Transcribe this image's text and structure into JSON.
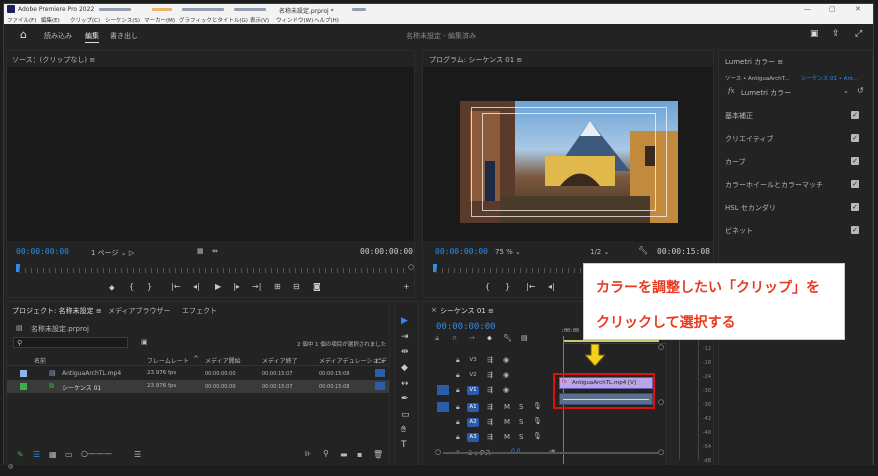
{
  "app": {
    "title": "Adobe Premiere Pro 2022",
    "doc_title": "名称未設定.prproj *"
  },
  "menu": [
    "ファイル(F)",
    "編集(E)",
    "クリップ(C)",
    "シーケンス(S)",
    "マーカー(M)",
    "グラフィックとタイトル(G)",
    "表示(V)",
    "ウィンドウ(W)",
    "ヘルプ(H)"
  ],
  "header": {
    "tabs": [
      "読み込み",
      "編集",
      "書き出し"
    ],
    "active_tab": "編集",
    "center": "名称未設定 - 編集済み"
  },
  "source": {
    "title": "ソース：(クリップなし)",
    "timecode_left": "00:00:00:00",
    "page": "1 ページ",
    "timecode_right": "00:00:00:00"
  },
  "program": {
    "title": "プログラム: シーケンス 01",
    "timecode_left": "00:00:00:00",
    "zoom": "75 %",
    "resolution": "1/2",
    "timecode_right": "00:00:15:08"
  },
  "lumetri": {
    "title": "Lumetri カラー",
    "source_clip": "ソース • AntiguaArchT...",
    "sequence_clip": "シーケンス 01 • Ant...",
    "fx_label": "Lumetri カラー",
    "sections": [
      "基本補正",
      "クリエイティブ",
      "カーブ",
      "カラーホイールとカラーマッチ",
      "HSL セカンダリ",
      "ビネット"
    ]
  },
  "project": {
    "tabs": [
      "プロジェクト: 名称未設定",
      "メディアブラウザー",
      "エフェクト"
    ],
    "file": "名称未設定.prproj",
    "status": "2 個中 1 個の項目が選択されました",
    "columns": [
      "名前",
      "フレームレート",
      "メディア開始",
      "メディア終了",
      "メディアデュレーション",
      "ビデ"
    ],
    "rows": [
      {
        "name": "AntiguaArchTL.mp4",
        "fps": "23.976 fps",
        "start": "00:00:00:00",
        "end": "00:00:15:07",
        "dur": "00:00:15:08",
        "color": "#8fb2e8"
      },
      {
        "name": "シーケンス 01",
        "fps": "23.976 fps",
        "start": "00:00:00:00",
        "end": "00:00:15:07",
        "dur": "00:00:15:08",
        "color": "#3cb043"
      }
    ]
  },
  "timeline": {
    "title": "シーケンス 01",
    "timecode": "00:00:00:00",
    "ruler_label": ":00:00",
    "tracks": [
      "V3",
      "V2",
      "V1",
      "A1",
      "A2",
      "A3"
    ],
    "mix_label": "ミックス",
    "mix_value": "0.0",
    "clip_label": "AntiguaArchTL.mp4 [V]"
  },
  "meter": {
    "labels": [
      "-12",
      "-18",
      "-24",
      "-30",
      "-36",
      "-42",
      "-48",
      "-54",
      "dB"
    ]
  },
  "callout": {
    "line1": "カラーを調整したい「クリップ」を",
    "line2": "クリックして選択する"
  }
}
